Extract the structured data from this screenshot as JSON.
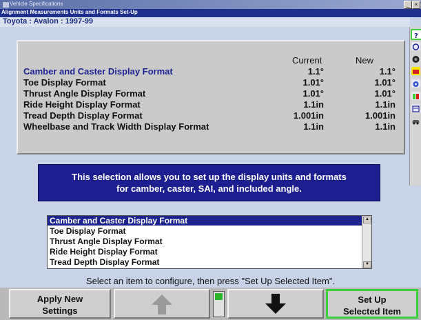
{
  "window": {
    "title": "Vehicle Specifications",
    "minimize_label": "_",
    "close_label": "×"
  },
  "screen": {
    "subtitle": "Alignment Measurements Units and Formats Set-Up",
    "vehicle": "Toyota : Avalon : 1997-99"
  },
  "table": {
    "col_current": "Current",
    "col_new": "New",
    "rows": [
      {
        "label": "Camber and Caster Display Format",
        "current": "1.1°",
        "new": "1.1°",
        "selected": true
      },
      {
        "label": "Toe Display Format",
        "current": "1.01°",
        "new": "1.01°"
      },
      {
        "label": "Thrust Angle Display Format",
        "current": "1.01°",
        "new": "1.01°"
      },
      {
        "label": "Ride Height Display Format",
        "current": "1.1in",
        "new": "1.1in"
      },
      {
        "label": "Tread Depth Display Format",
        "current": "1.001in",
        "new": "1.001in"
      },
      {
        "label": "Wheelbase and Track Width Display Format",
        "current": "1.1in",
        "new": "1.1in"
      }
    ]
  },
  "info": {
    "line1": "This selection allows you to set up the display units and formats",
    "line2": "for camber, caster, SAI, and included angle."
  },
  "list": {
    "items": [
      {
        "label": "Camber and Caster Display Format",
        "selected": true
      },
      {
        "label": "Toe Display Format"
      },
      {
        "label": "Thrust Angle Display Format"
      },
      {
        "label": "Ride Height Display Format"
      },
      {
        "label": "Tread Depth Display Format"
      }
    ],
    "scroll_up": "▲",
    "scroll_down": "▼"
  },
  "instruction": "Select an item to configure, then press \"Set Up Selected Item\".",
  "buttons": {
    "apply_line1": "Apply New",
    "apply_line2": "Settings",
    "setup_line1": "Set Up",
    "setup_line2": "Selected Item"
  },
  "toolbar_icons": [
    "help-icon",
    "settings-icon",
    "wheel-icon",
    "readings-icon",
    "alignment-icon",
    "tools-icon",
    "specs-icon",
    "vehicle-icon"
  ],
  "colors": {
    "selection": "#1d2490",
    "info_bg": "#1d1f90",
    "active_button_border": "#3ccf3c"
  }
}
